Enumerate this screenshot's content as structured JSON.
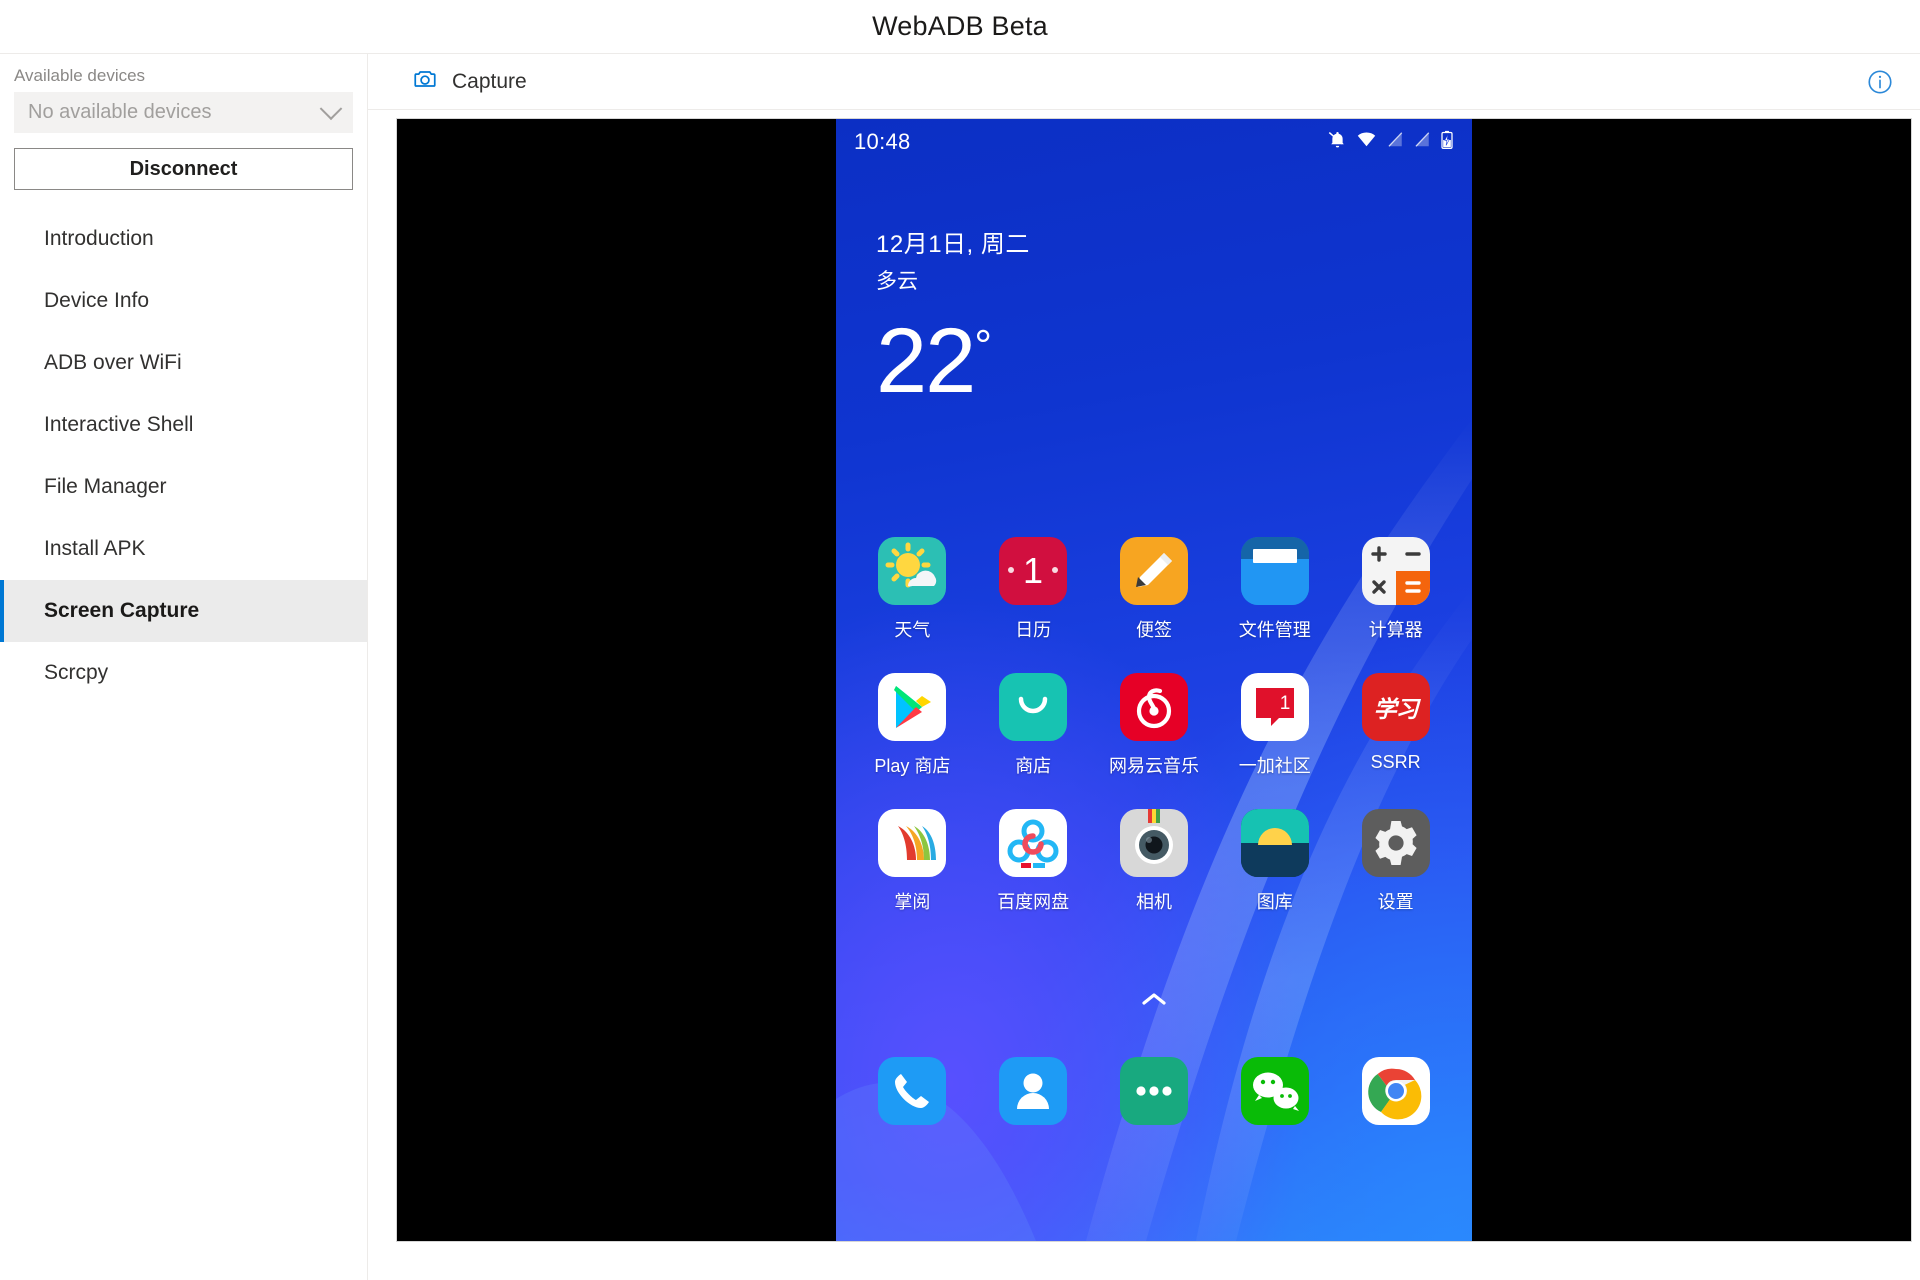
{
  "window": {
    "title": "WebADB Beta"
  },
  "sidebar": {
    "devices_label": "Available devices",
    "device_select_value": "No available devices",
    "device_select_icon": "chevron-down-icon",
    "disconnect_label": "Disconnect",
    "items": [
      {
        "label": "Introduction",
        "selected": false
      },
      {
        "label": "Device Info",
        "selected": false
      },
      {
        "label": "ADB over WiFi",
        "selected": false
      },
      {
        "label": "Interactive Shell",
        "selected": false
      },
      {
        "label": "File Manager",
        "selected": false
      },
      {
        "label": "Install APK",
        "selected": false
      },
      {
        "label": "Screen Capture",
        "selected": true
      },
      {
        "label": "Scrcpy",
        "selected": false
      }
    ],
    "accent_color": "#0078d4",
    "selected_bg": "#ebebeb"
  },
  "toolbar": {
    "capture_label": "Capture",
    "capture_icon": "camera-icon",
    "info_icon": "info-circle-icon",
    "icon_color": "#0078d4"
  },
  "phone": {
    "statusbar": {
      "time": "10:48",
      "icons": [
        "bell-off-icon",
        "wifi-icon",
        "signal-off-1-icon",
        "signal-off-2-icon",
        "battery-charging-icon"
      ]
    },
    "weather": {
      "date": "12月1日, 周二",
      "condition": "多云",
      "temperature": "22",
      "degree": "°"
    },
    "drawer_arrow_icon": "chevron-up-icon",
    "grid": [
      [
        {
          "label": "天气",
          "icon": "weather-app-icon"
        },
        {
          "label": "日历",
          "icon": "calendar-app-icon"
        },
        {
          "label": "便签",
          "icon": "notes-app-icon"
        },
        {
          "label": "文件管理",
          "icon": "file-manager-app-icon"
        },
        {
          "label": "计算器",
          "icon": "calculator-app-icon"
        }
      ],
      [
        {
          "label": "Play 商店",
          "icon": "play-store-app-icon"
        },
        {
          "label": "商店",
          "icon": "oneplus-store-app-icon"
        },
        {
          "label": "网易云音乐",
          "icon": "netease-music-app-icon"
        },
        {
          "label": "一加社区",
          "icon": "oneplus-community-app-icon"
        },
        {
          "label": "SSRR",
          "icon": "ssrr-app-icon"
        }
      ],
      [
        {
          "label": "掌阅",
          "icon": "ireader-app-icon"
        },
        {
          "label": "百度网盘",
          "icon": "baidu-netdisk-app-icon"
        },
        {
          "label": "相机",
          "icon": "camera-app-icon"
        },
        {
          "label": "图库",
          "icon": "gallery-app-icon"
        },
        {
          "label": "设置",
          "icon": "settings-app-icon"
        }
      ]
    ],
    "dock": [
      {
        "label": "",
        "icon": "phone-app-icon"
      },
      {
        "label": "",
        "icon": "contacts-app-icon"
      },
      {
        "label": "",
        "icon": "messages-app-icon"
      },
      {
        "label": "",
        "icon": "wechat-app-icon"
      },
      {
        "label": "",
        "icon": "chrome-app-icon"
      }
    ],
    "calendar_day": "1",
    "oneplus_badge": "1",
    "ssrr_text": "学习"
  }
}
